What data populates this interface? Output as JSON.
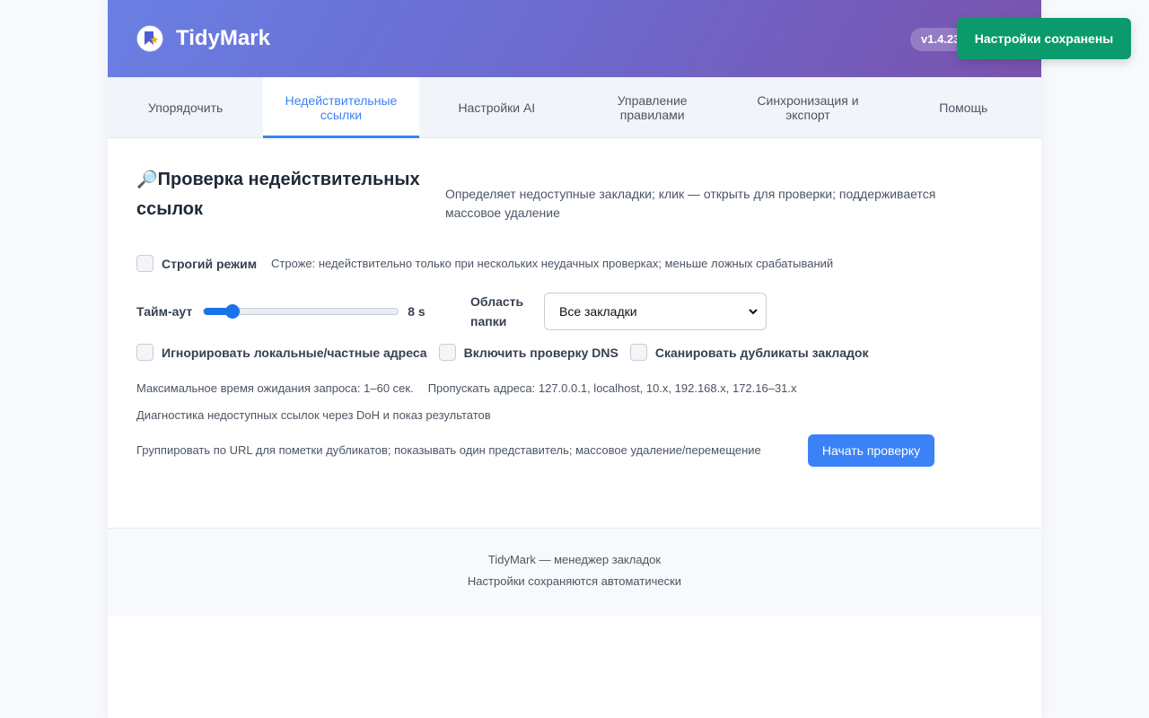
{
  "header": {
    "app_name": "TidyMark",
    "version": "v1.4.23",
    "logo_icon": "bookmark-star-icon"
  },
  "toast": {
    "text": "Настройки сохранены",
    "color": "#0b9a6b"
  },
  "tabs": [
    {
      "label": "Упорядочить",
      "active": false
    },
    {
      "label": "Недействительные ссылки",
      "active": true
    },
    {
      "label": "Настройки AI",
      "active": false
    },
    {
      "label": "Управление правилами",
      "active": false
    },
    {
      "label": "Синхронизация и экспорт",
      "active": false
    },
    {
      "label": "Помощь",
      "active": false
    }
  ],
  "section": {
    "icon": "magnifier-icon",
    "title": "Проверка недействительных ссылок",
    "description": "Определяет недоступные закладки; клик — открыть для проверки; поддерживается массовое удаление"
  },
  "strict_mode": {
    "label": "Строгий режим",
    "hint": "Строже: недействительно только при нескольких неудачных проверках; меньше ложных срабатываний",
    "checked": false
  },
  "timeout": {
    "label": "Тайм-аут",
    "value_text": "8 s",
    "value": 8,
    "min": 1,
    "max": 60
  },
  "folder_scope": {
    "label": "Область папки",
    "selected": "Все закладки"
  },
  "options": {
    "ignore_local": {
      "label": "Игнорировать локальные/частные адреса",
      "checked": false
    },
    "dns_check": {
      "label": "Включить проверку DNS",
      "checked": false
    },
    "dup_scan": {
      "label": "Сканировать дубликаты закладок",
      "checked": false
    }
  },
  "hints": {
    "timeout_hint": "Максимальное время ожидания запроса: 1–60 сек.",
    "ignore_hint": "Пропускать адреса: 127.0.0.1, localhost, 10.x, 192.168.x, 172.16–31.x",
    "dns_hint": "Диагностика недоступных ссылок через DoH и показ результатов",
    "dup_hint": "Группировать по URL для пометки дубликатов; показывать один представитель; массовое удаление/перемещение"
  },
  "start_button": {
    "label": "Начать проверку",
    "color": "#3b82f6"
  },
  "footer": {
    "line1": "TidyMark — менеджер закладок",
    "line2": "Настройки сохраняются автоматически"
  },
  "colors": {
    "accent": "#3b82f6",
    "header_start": "#6a7fe3",
    "header_end": "#7a52ad"
  }
}
